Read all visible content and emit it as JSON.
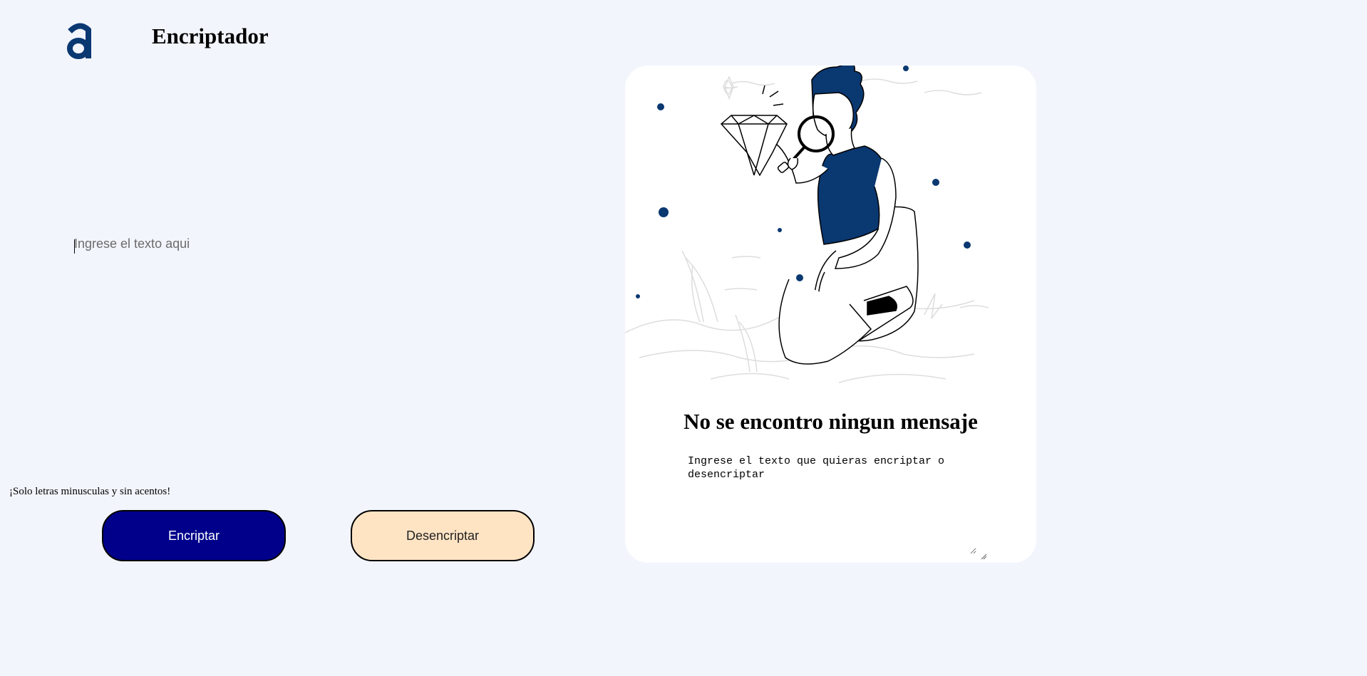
{
  "header": {
    "logo_icon": "alura-a-logo-icon",
    "title": "Encriptador"
  },
  "input": {
    "placeholder": "Ingrese el texto aqui",
    "value": ""
  },
  "hint": {
    "text": "¡Solo letras minusculas y sin acentos!"
  },
  "buttons": {
    "encrypt_label": "Encriptar",
    "decrypt_label": "Desencriptar"
  },
  "output": {
    "illustration": "person-with-magnifying-glass-illustration",
    "title": "No se encontro ningun mensaje",
    "text": "Ingrese el texto que quieras encriptar o desencriptar"
  },
  "colors": {
    "background": "#f2f5fc",
    "accent_dark_blue": "#0a3871",
    "encrypt_button": "#00008b",
    "decrypt_button": "#ffe4c4"
  }
}
